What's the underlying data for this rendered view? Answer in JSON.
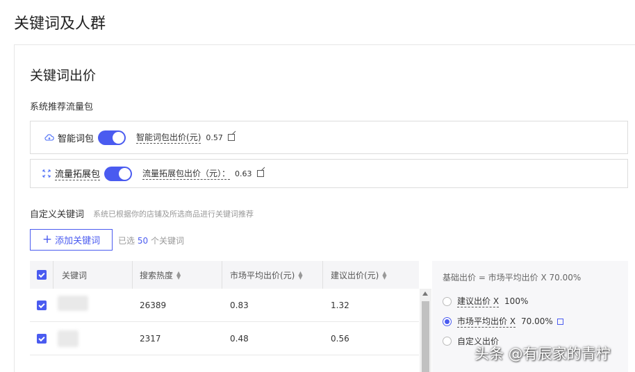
{
  "page": {
    "title": "关键词及人群"
  },
  "section": {
    "title": "关键词出价",
    "subtitle": "系统推荐流量包"
  },
  "packages": [
    {
      "icon": "cloud-icon",
      "name": "智能词包",
      "enabled": true,
      "bid_label": "智能词包出价(元)",
      "bid_value": "0.57"
    },
    {
      "icon": "expand-arrows-icon",
      "name": "流量拓展包",
      "enabled": true,
      "bid_label": "流量拓展包出价（元）：",
      "bid_value": "0.63"
    }
  ],
  "custom": {
    "title": "自定义关键词",
    "hint": "系统已根据你的店铺及所选商品进行关键词推荐",
    "add_button": "添加关键词",
    "selected_prefix": "已选",
    "selected_count": "50",
    "selected_suffix": "个关键词"
  },
  "table": {
    "columns": [
      "关键词",
      "搜索热度",
      "市场平均出价(元)",
      "建议出价(元)"
    ],
    "rows": [
      {
        "keyword": "",
        "heat": "26389",
        "avg_bid": "0.83",
        "suggested_bid": "1.32",
        "checked": true
      },
      {
        "keyword": "",
        "heat": "2317",
        "avg_bid": "0.48",
        "suggested_bid": "0.56",
        "checked": true
      }
    ]
  },
  "bid_panel": {
    "formula": "基础出价 = 市场平均出价 X 70.00%",
    "options": [
      {
        "label": "建议出价 X",
        "value": "100%",
        "checked": false
      },
      {
        "label": "市场平均出价 X",
        "value": "70.00%",
        "checked": true
      },
      {
        "label": "自定义出价",
        "value": "",
        "checked": false
      }
    ]
  },
  "watermark": "头条 @有辰家的青柠",
  "colors": {
    "accent": "#4a5bf0",
    "border": "#dcdcdc",
    "header_bg": "#f5f5f7"
  }
}
